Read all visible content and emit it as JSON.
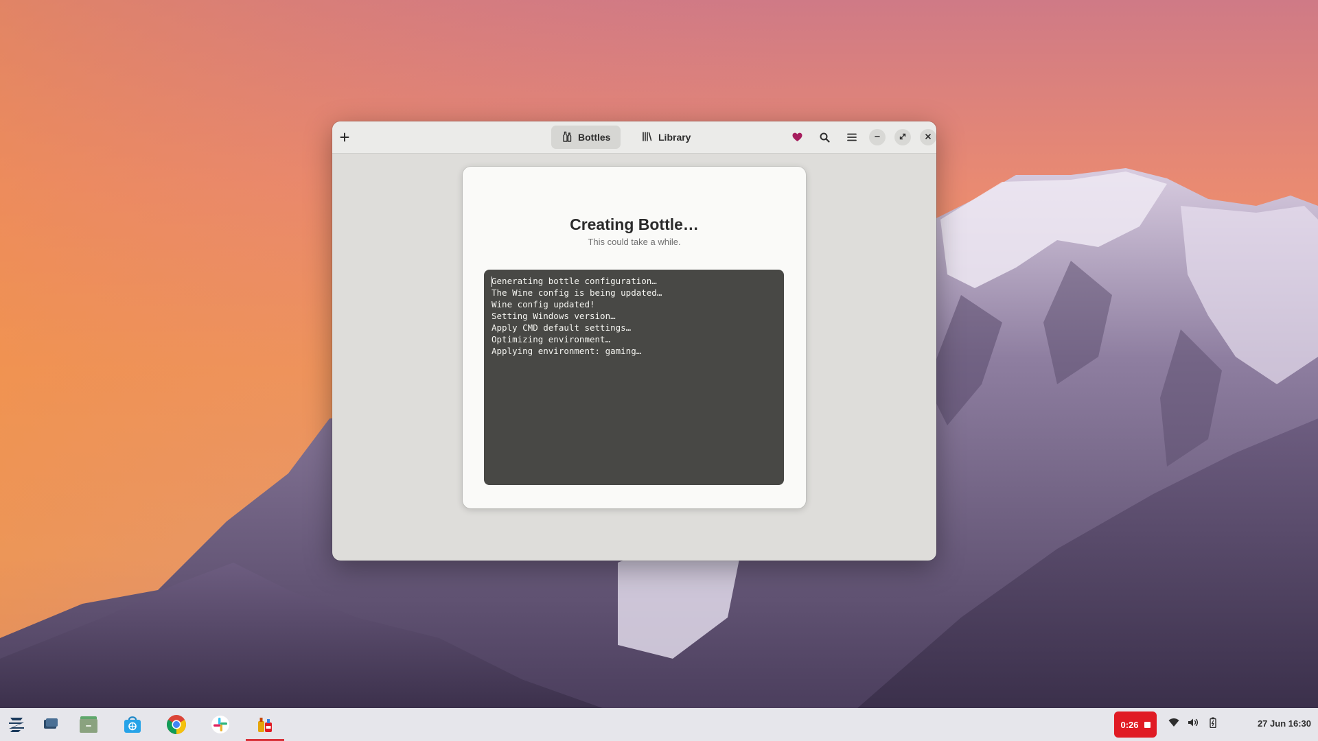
{
  "window": {
    "tabs": [
      {
        "label": "Bottles",
        "icon": "bottles-icon",
        "active": true
      },
      {
        "label": "Library",
        "icon": "library-icon",
        "active": false
      }
    ],
    "header_icons": [
      "add-icon",
      "heart-icon",
      "search-icon",
      "menu-icon",
      "minimize-icon",
      "maximize-icon",
      "close-icon"
    ],
    "accent_heart": "#a51d5d"
  },
  "dialog": {
    "title": "Creating Bottle…",
    "subtitle": "This could take a while.",
    "log_lines": [
      "Generating bottle configuration…",
      "The Wine config is being updated…",
      "Wine config updated!",
      "Setting Windows version…",
      "Apply CMD default settings…",
      "Optimizing environment…",
      "Applying environment: gaming…"
    ]
  },
  "taskbar": {
    "apps": [
      "zorin-menu-icon",
      "workspaces-icon",
      "files-icon",
      "software-store-icon",
      "chrome-icon",
      "slack-icon",
      "bottles-app-icon"
    ],
    "recording_time": "0:26",
    "recording_color": "#e01b24",
    "tray_icons": [
      "wifi-icon",
      "volume-icon",
      "battery-icon"
    ],
    "clock": "27 Jun  16:30"
  }
}
